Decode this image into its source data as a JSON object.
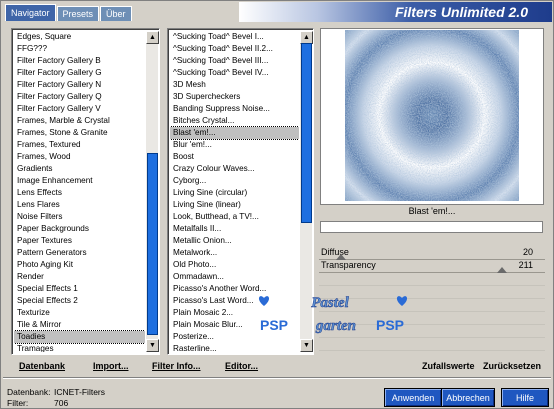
{
  "tabs": [
    {
      "label": "Navigator",
      "active": true
    },
    {
      "label": "Presets",
      "active": false
    },
    {
      "label": "Über",
      "active": false
    }
  ],
  "title": "Filters Unlimited 2.0",
  "categories": [
    "Edges, Square",
    "FFG???",
    "Filter Factory Gallery B",
    "Filter Factory Gallery G",
    "Filter Factory Gallery N",
    "Filter Factory Gallery Q",
    "Filter Factory Gallery V",
    "Frames, Marble & Crystal",
    "Frames, Stone & Granite",
    "Frames, Textured",
    "Frames, Wood",
    "Gradients",
    "Image Enhancement",
    "Lens Effects",
    "Lens Flares",
    "Noise Filters",
    "Paper Backgrounds",
    "Paper Textures",
    "Pattern Generators",
    "Photo Aging Kit",
    "Render",
    "Special Effects 1",
    "Special Effects 2",
    "Texturize",
    "Tile & Mirror",
    "Toadies",
    "Tramages"
  ],
  "selected_category": "Toadies",
  "filters": [
    "^Sucking Toad^ Bevel I...",
    "^Sucking Toad^ Bevel II.2...",
    "^Sucking Toad^ Bevel III...",
    "^Sucking Toad^ Bevel IV...",
    "3D Mesh",
    "3D Supercheckers",
    "Banding Suppress Noise...",
    "Bitches Crystal...",
    "Blast 'em!...",
    "Blur 'em!...",
    "Boost",
    "Crazy Colour Waves...",
    "Cyborg...",
    "Living Sine (circular)",
    "Living Sine (linear)",
    "Look, Butthead, a TV!...",
    "Metalfalls II...",
    "Metallic Onion...",
    "Metalwork...",
    "Old Photo...",
    "Ommadawn...",
    "Picasso's Another Word...",
    "Picasso's Last Word...",
    "Plain Mosaic 2...",
    "Plain Mosaic Blur...",
    "Posterize...",
    "Rasterline..."
  ],
  "selected_filter": "Blast 'em!...",
  "preview_caption": "Blast 'em!...",
  "sliders": [
    {
      "label": "Diffuse",
      "value": "20",
      "level": 0.08
    },
    {
      "label": "Transparency",
      "value": "211",
      "level": 0.83
    }
  ],
  "watermark_lines": [
    "Pastel",
    "garten"
  ],
  "watermark_badge": "PSP",
  "links": {
    "datenbank": "Datenbank",
    "import": "Import...",
    "filter_info": "Filter Info...",
    "editor": "Editor...",
    "zufallswerte": "Zufallswerte",
    "zuruecksetzen": "Zurücksetzen"
  },
  "info": {
    "datenbank_label": "Datenbank:",
    "datenbank_value": "ICNET-Filters",
    "filter_label": "Filter:",
    "filter_value": "706"
  },
  "buttons": {
    "apply": "Anwenden",
    "cancel": "Abbrechen",
    "help": "Hilfe"
  },
  "colors": {
    "accent": "#1f57c0",
    "banner": "#1e3c8c",
    "ring_light": "#ffffff",
    "ring_dark": "#6d8fb8"
  }
}
